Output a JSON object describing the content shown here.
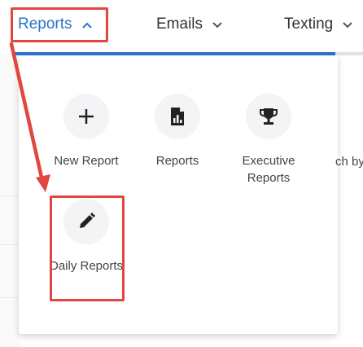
{
  "nav": {
    "reports_label": "Reports",
    "emails_label": "Emails",
    "texting_label": "Texting",
    "reports_chevron": "chevron-up-icon",
    "emails_chevron": "chevron-down-icon",
    "texting_chevron": "chevron-down-icon"
  },
  "dropdown": {
    "items": [
      {
        "label": "New Report",
        "icon": "plus-icon"
      },
      {
        "label": "Reports",
        "icon": "report-file-icon"
      },
      {
        "label": "Executive Reports",
        "icon": "trophy-icon"
      },
      {
        "label": "ch by",
        "icon": ""
      },
      {
        "label": "Daily Reports",
        "icon": "pencil-icon"
      }
    ]
  },
  "colors": {
    "accent": "#2a73c9",
    "highlight": "#e0473f",
    "icon_bg": "#f3f4f6"
  }
}
